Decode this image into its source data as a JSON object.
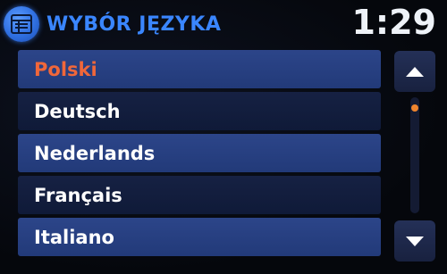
{
  "header": {
    "title": "WYBÓR JĘZYKA",
    "icon": "language-settings-icon",
    "accent_color": "#3a86ff"
  },
  "clock": {
    "time": "1:29"
  },
  "languages": [
    {
      "label": "Polski",
      "selected": true
    },
    {
      "label": "Deutsch",
      "selected": false
    },
    {
      "label": "Nederlands",
      "selected": false
    },
    {
      "label": "Français",
      "selected": false
    },
    {
      "label": "Italiano",
      "selected": false
    }
  ],
  "scrollbar": {
    "up_icon": "scroll-up-icon",
    "down_icon": "scroll-down-icon",
    "position_fraction": 0.0,
    "thumb_color": "#f0852e"
  },
  "colors": {
    "selected_text": "#f0673a",
    "row_dark": "#162143",
    "row_light": "#2c4589"
  }
}
